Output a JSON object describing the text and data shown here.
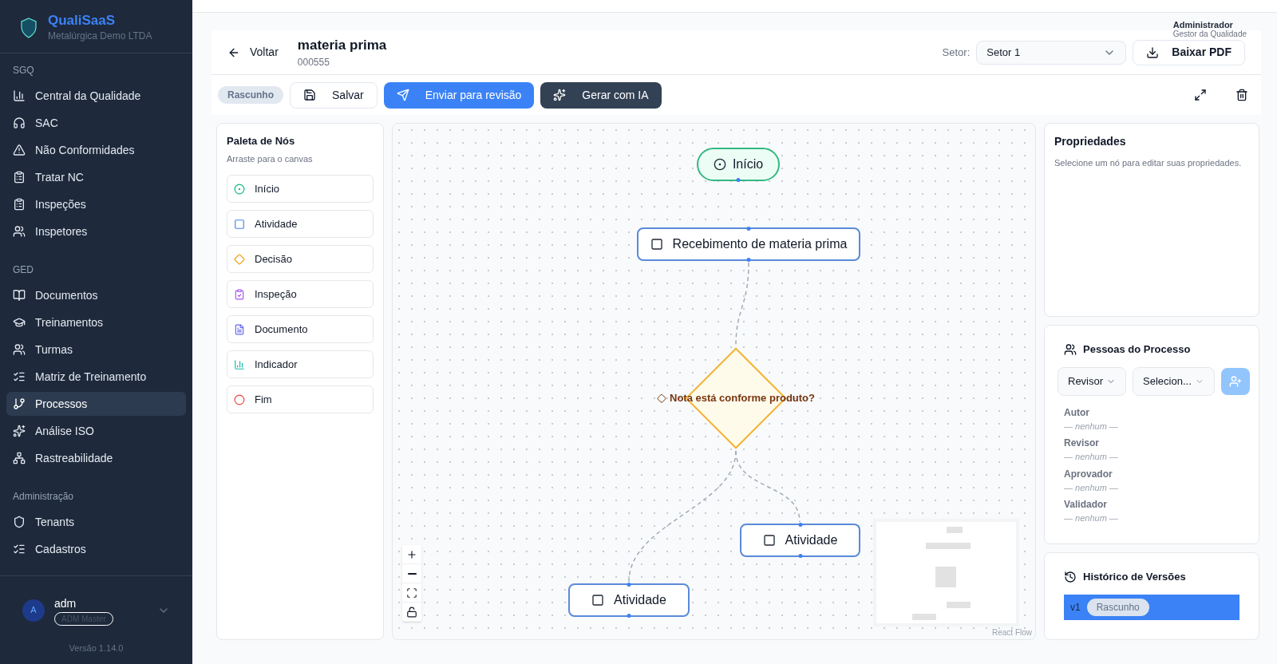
{
  "sidebar": {
    "brand": "QualiSaaS",
    "company": "Metalúrgica Demo LTDA",
    "sections": [
      {
        "title": "SGQ",
        "items": [
          {
            "label": "Central da Qualidade",
            "selected": false
          },
          {
            "label": "SAC",
            "selected": false
          },
          {
            "label": "Não Conformidades",
            "selected": false
          },
          {
            "label": "Tratar NC",
            "selected": false
          },
          {
            "label": "Inspeções",
            "selected": false
          },
          {
            "label": "Inspetores",
            "selected": false
          }
        ]
      },
      {
        "title": "GED",
        "items": [
          {
            "label": "Documentos",
            "selected": false
          },
          {
            "label": "Treinamentos",
            "selected": false
          },
          {
            "label": "Turmas",
            "selected": false
          },
          {
            "label": "Matriz de Treinamento",
            "selected": false
          },
          {
            "label": "Processos",
            "selected": true
          },
          {
            "label": "Análise ISO",
            "selected": false
          },
          {
            "label": "Rastreabilidade",
            "selected": false
          }
        ]
      },
      {
        "title": "Administração",
        "items": [
          {
            "label": "Tenants",
            "selected": false
          },
          {
            "label": "Cadastros",
            "selected": false
          }
        ]
      }
    ],
    "user": {
      "initial": "A",
      "name": "adm",
      "role": "ADM Master"
    },
    "version": "Versão 1.14.0"
  },
  "topbar": {
    "user_name": "Administrador",
    "user_role": "Gestor da Qualidade"
  },
  "header": {
    "back": "Voltar",
    "title": "materia prima",
    "code": "000555",
    "sector_label": "Setor:",
    "sector_value": "Setor 1",
    "download": "Baixar PDF"
  },
  "toolbar": {
    "status": "Rascunho",
    "buttons": [
      {
        "label": "Salvar",
        "kind": "save"
      },
      {
        "label": "Enviar para revisão",
        "kind": "send"
      },
      {
        "label": "Gerar com IA",
        "kind": "ai"
      }
    ]
  },
  "palette": {
    "title": "Paleta de Nós",
    "hint": "Arraste para o canvas",
    "items": [
      {
        "label": "Início",
        "kind": "start"
      },
      {
        "label": "Atividade",
        "kind": "activity"
      },
      {
        "label": "Decisão",
        "kind": "decision"
      },
      {
        "label": "Inspeção",
        "kind": "inspection"
      },
      {
        "label": "Documento",
        "kind": "document"
      },
      {
        "label": "Indicador",
        "kind": "indicator"
      },
      {
        "label": "Fim",
        "kind": "end"
      }
    ]
  },
  "canvas": {
    "nodes": [
      {
        "label": "Início",
        "kind": "start"
      },
      {
        "label": "Recebimento de materia prima",
        "kind": "activity"
      },
      {
        "label": "Nota está conforme produto?",
        "kind": "decision"
      },
      {
        "label": "Atividade",
        "kind": "activity"
      },
      {
        "label": "Atividade",
        "kind": "activity"
      }
    ],
    "attribution": "React Flow"
  },
  "properties": {
    "title": "Propriedades",
    "hint": "Selecione um nó para editar suas propriedades."
  },
  "people": {
    "title": "Pessoas do Processo",
    "role_select": "Revisor",
    "person_select": "Selecion...",
    "roles": [
      {
        "label": "Autor",
        "value": "— nenhum —"
      },
      {
        "label": "Revisor",
        "value": "— nenhum —"
      },
      {
        "label": "Aprovador",
        "value": "— nenhum —"
      },
      {
        "label": "Validador",
        "value": "— nenhum —"
      }
    ]
  },
  "history": {
    "title": "Histórico de Versões",
    "versions": [
      {
        "version": "v1",
        "status": "Rascunho",
        "selected": true
      }
    ]
  }
}
